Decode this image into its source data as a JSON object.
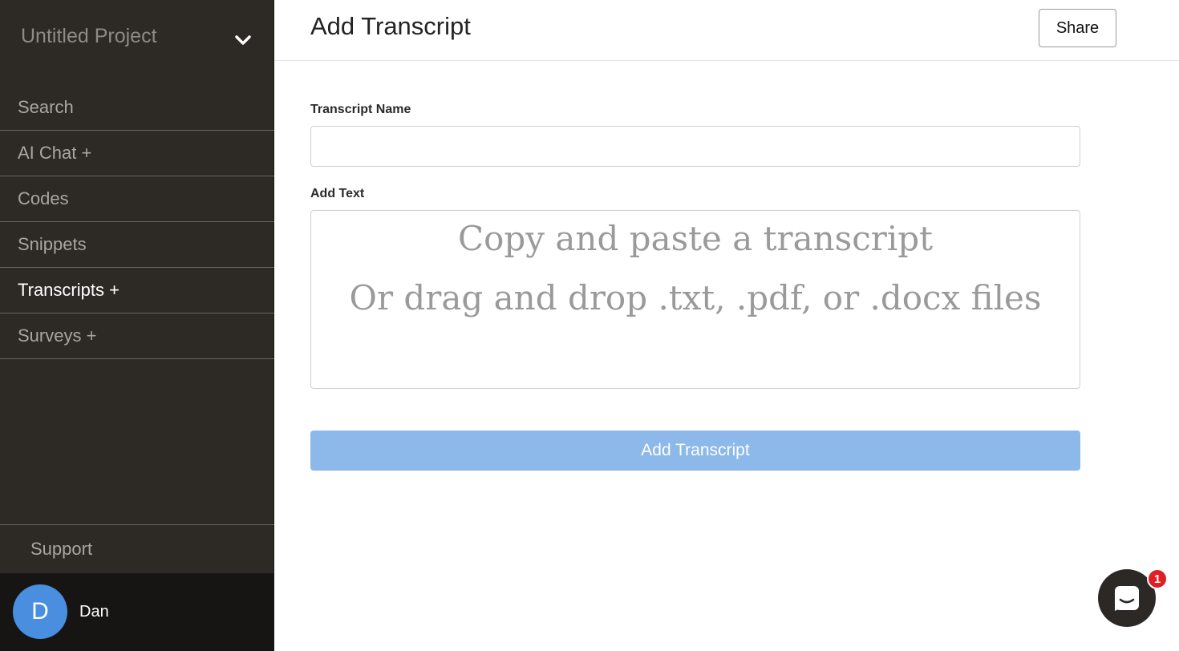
{
  "sidebar": {
    "project_title": "Untitled Project",
    "nav_items": [
      {
        "label": "Search"
      },
      {
        "label": "AI Chat +"
      },
      {
        "label": "Codes"
      },
      {
        "label": "Snippets"
      },
      {
        "label": "Transcripts +",
        "active": true
      },
      {
        "label": "Surveys +"
      }
    ],
    "support_label": "Support",
    "user": {
      "initial": "D",
      "name": "Dan",
      "avatar_color": "#4a8ee0"
    }
  },
  "header": {
    "title": "Add Transcript",
    "share_label": "Share"
  },
  "form": {
    "name_label": "Transcript Name",
    "name_value": "",
    "text_label": "Add Text",
    "dropzone_line1": "Copy and paste a transcript",
    "dropzone_line2": "Or drag and drop .txt, .pdf, or .docx files",
    "submit_label": "Add Transcript",
    "submit_color": "#8db8ea"
  },
  "chat": {
    "icon": "chat-bubble-icon",
    "badge_count": "1"
  }
}
